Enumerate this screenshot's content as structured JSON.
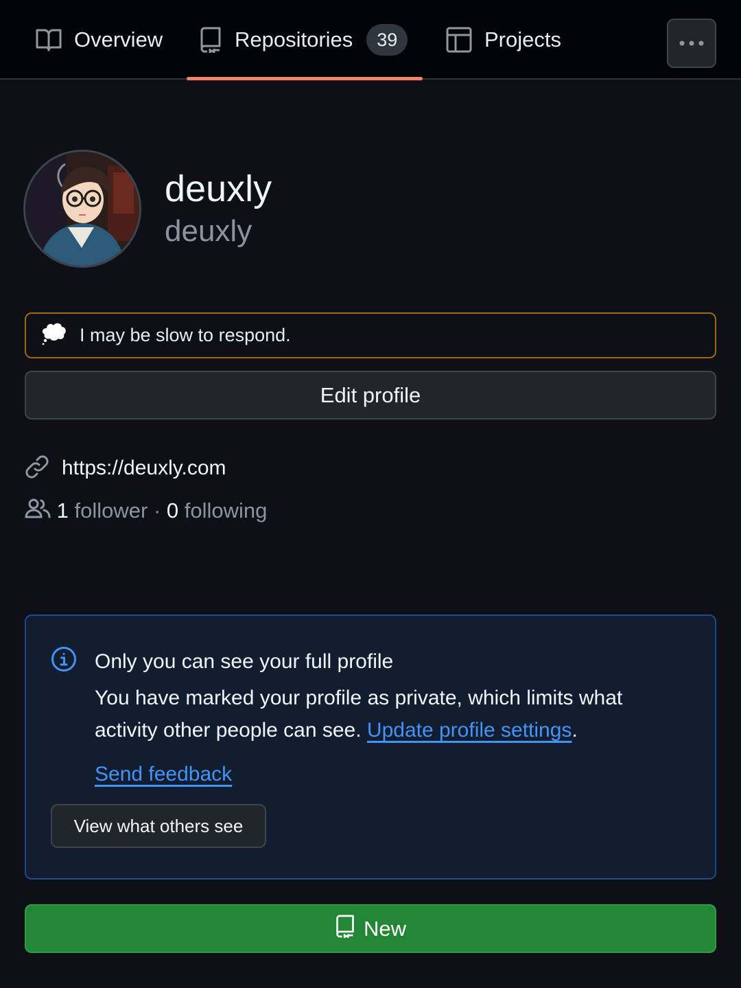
{
  "nav": {
    "tabs": [
      {
        "label": "Overview",
        "icon": "book-icon"
      },
      {
        "label": "Repositories",
        "icon": "repo-icon",
        "count": "39",
        "selected": true
      },
      {
        "label": "Projects",
        "icon": "table-icon"
      }
    ],
    "more_icon": "kebab-horizontal-icon"
  },
  "profile": {
    "display_name": "deuxly",
    "username": "deuxly",
    "status": "I may be slow to respond.",
    "status_icon": "thought-balloon-icon",
    "edit_label": "Edit profile",
    "website": "https://deuxly.com",
    "followers_count": "1",
    "followers_label": "follower",
    "separator": "·",
    "following_count": "0",
    "following_label": "following"
  },
  "notice": {
    "title": "Only you can see your full profile",
    "body": "You have marked your profile as private, which limits what activity other people can see.",
    "link": "Update profile settings",
    "after_link": ".",
    "feedback": "Send feedback",
    "view_button": "View what others see"
  },
  "new_button": {
    "label": "New",
    "icon": "repo-icon"
  },
  "colors": {
    "background": "#0d1117",
    "accent_underline": "#f78166",
    "link": "#4493f8",
    "status_border": "#9e6a03",
    "notice_border": "#1f4a8a",
    "new_button": "#238636"
  }
}
